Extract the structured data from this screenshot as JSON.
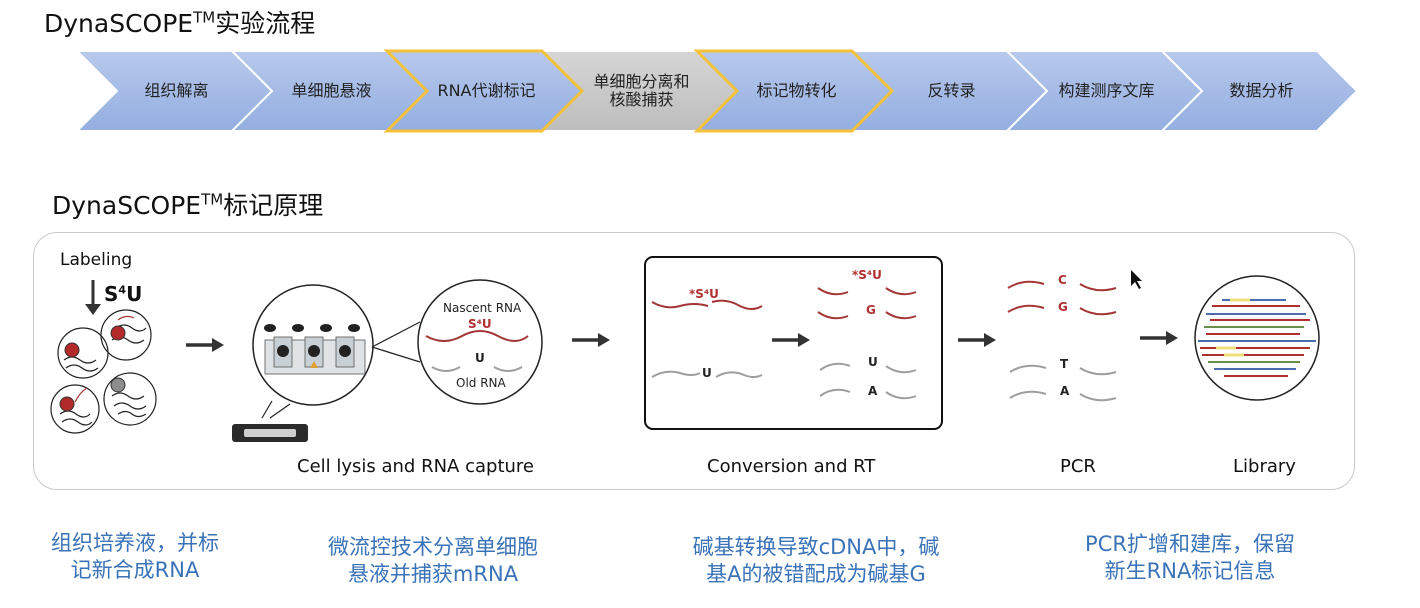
{
  "title1": {
    "main": "DynaSCOPE",
    "tm": "TM",
    "rest": "实验流程"
  },
  "title2": {
    "main": "DynaSCOPE",
    "tm": "TM",
    "rest": "标记原理"
  },
  "steps": [
    "组织解离",
    "单细胞悬液",
    "RNA代谢标记",
    "单细胞分离和\n核酸捕获",
    "标记物转化",
    "反转录",
    "构建测序文库",
    "数据分析"
  ],
  "highlighted_steps": [
    2,
    4
  ],
  "colors": {
    "step_blue": "#a9bee6",
    "step_gray": "#c9c9c9",
    "highlight_border": "#f3c13a",
    "desc_blue": "#3a73b8",
    "rna_red": "#a43636",
    "rna_gray": "#9e9e9e"
  },
  "panel": {
    "labeling": "Labeling",
    "s4u": "S",
    "s4u_sup": "4",
    "s4u_tail": "U",
    "nascent_rna": "Nascent RNA",
    "old_rna": "Old RNA",
    "mark_s4u": "S⁴U",
    "mark_star_s4u": "*S⁴U",
    "mark_u": "U",
    "mark_g": "G",
    "mark_a": "A",
    "mark_c": "C",
    "mark_t": "T",
    "cap_lysis": "Cell lysis and RNA capture",
    "cap_conversion": "Conversion and RT",
    "cap_pcr": "PCR",
    "cap_library": "Library"
  },
  "descriptions": [
    "组织培养液，并标\n记新合成RNA",
    "微流控技术分离单细胞\n悬液并捕获mRNA",
    "碱基转换导致cDNA中，碱\n基A的被错配成为碱基G",
    "PCR扩增和建库，保留\n新生RNA标记信息"
  ]
}
